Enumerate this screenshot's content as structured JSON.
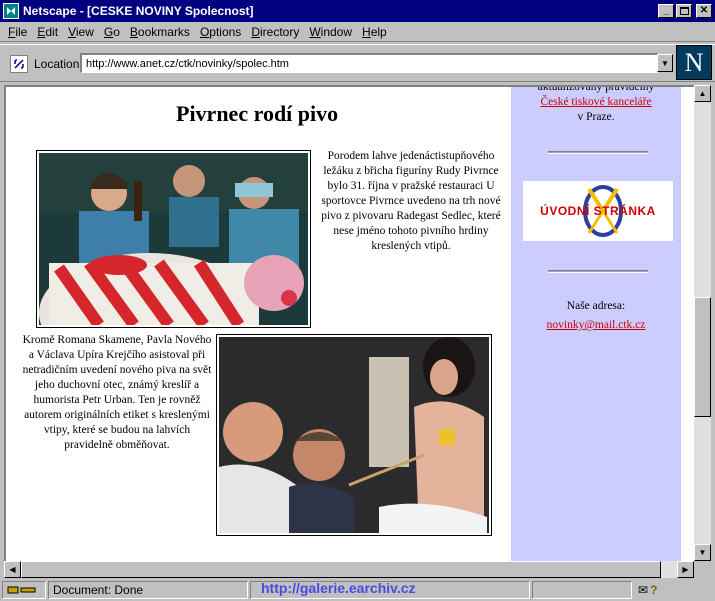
{
  "window": {
    "title": "Netscape - [CESKE NOVINY Spolecnost]",
    "controls": [
      "minimize",
      "maximize",
      "close"
    ]
  },
  "menu": {
    "items": [
      {
        "key": "F",
        "rest": "ile"
      },
      {
        "key": "E",
        "rest": "dit"
      },
      {
        "key": "V",
        "rest": "iew"
      },
      {
        "key": "G",
        "rest": "o"
      },
      {
        "key": "B",
        "rest": "ookmarks"
      },
      {
        "key": "O",
        "rest": "ptions"
      },
      {
        "key": "D",
        "rest": "irectory"
      },
      {
        "key": "W",
        "rest": "indow"
      },
      {
        "key": "H",
        "rest": "elp"
      }
    ]
  },
  "location": {
    "label": "Location:",
    "url": "http://www.anet.cz/ctk/novinky/spolec.htm"
  },
  "brand_logo": "N",
  "article": {
    "headline": "Pivrnec rodí pivo",
    "paragraph1": "Porodem lahve jedenáctistupňového ležáku z břicha figuríny Rudy Pivrnce bylo 31. října v pražské restauraci U sportovce Pivrnce uvedeno na trh nové pivo z pivovaru Radegast Sedlec, které nese jméno tohoto pivního hrdiny kreslených vtipů.",
    "paragraph2": "Kromě Romana Skamene, Pavla Nového a Václava Upíra Krejčího asistoval při netradičním uvedení nového piva na svět jeho duchovní otec, známý kreslíř a humorista Petr Urban. Ten je rovněž autorem originálních etiket s kreslenými vtipy, které se budou na lahvích pravidelně obměňovat."
  },
  "sidebar": {
    "partial_text": "aktualizovaný pravidelný",
    "link1": "České tiskové kanceláře",
    "after_link1": "v Praze.",
    "banner_text": "ÚVODNÍ STRÁNKA",
    "address_label": "Naše adresa:",
    "email": "novinky@mail.ctk.cz"
  },
  "status": {
    "text": "Document: Done"
  },
  "watermark": "http://galerie.earchiv.cz",
  "colors": {
    "titlebar": "#000080",
    "sidebar_bg": "#ccccff",
    "link": "#cc0000",
    "watermark": "#4a4adf"
  }
}
